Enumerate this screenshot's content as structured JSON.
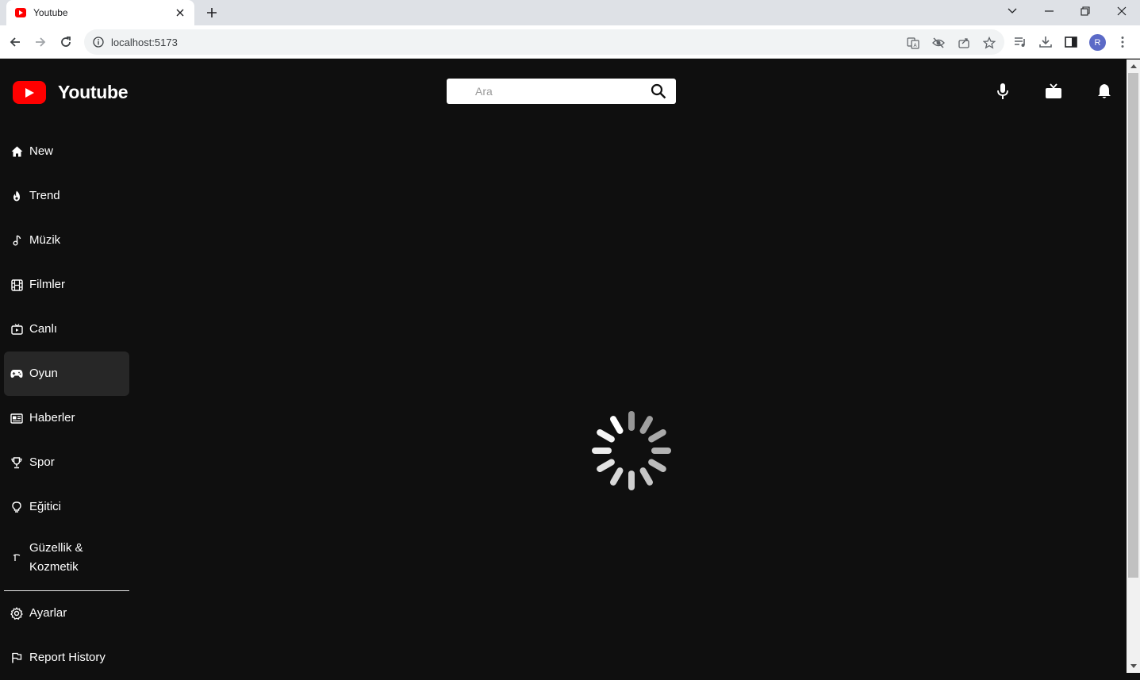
{
  "browser": {
    "tab_title": "Youtube",
    "url": "localhost:5173",
    "profile_initial": "R"
  },
  "app": {
    "logo_text": "Youtube",
    "brand_color": "#ff0000",
    "search_placeholder": "Ara"
  },
  "sidebar": {
    "items": [
      {
        "label": "New",
        "icon": "home-icon"
      },
      {
        "label": "Trend",
        "icon": "flame-icon"
      },
      {
        "label": "Müzik",
        "icon": "music-note-icon"
      },
      {
        "label": "Filmler",
        "icon": "film-icon"
      },
      {
        "label": "Canlı",
        "icon": "live-tv-icon"
      },
      {
        "label": "Oyun",
        "icon": "gamepad-icon",
        "active": true
      },
      {
        "label": "Haberler",
        "icon": "newspaper-icon"
      },
      {
        "label": "Spor",
        "icon": "trophy-icon"
      },
      {
        "label": "Eğitici",
        "icon": "lightbulb-icon"
      },
      {
        "label": "Güzellik & Kozmetik",
        "icon": "hanger-icon"
      }
    ],
    "footer_items": [
      {
        "label": "Ayarlar",
        "icon": "gear-icon"
      },
      {
        "label": "Report History",
        "icon": "flag-icon"
      }
    ]
  }
}
